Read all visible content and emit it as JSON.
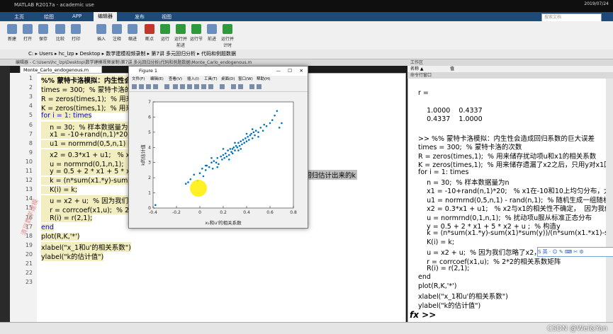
{
  "window": {
    "title": "MATLAB R2017a - academic use",
    "clock": "2019/07/24"
  },
  "ribbon": {
    "tabs": [
      "主页",
      "绘图",
      "APP",
      "编辑器",
      "发布",
      "视图"
    ],
    "active_tab": "编辑器",
    "search_placeholder": "搜索文档",
    "buttons": [
      "新建",
      "打开",
      "保存",
      "比较",
      "打印",
      "插入",
      "注释",
      "缩进",
      "断点",
      "运行",
      "运行并前进",
      "运行节",
      "前进",
      "运行并计时"
    ]
  },
  "pathbar": {
    "path": "C: ▸ Users ▸ hc_lzp ▸ Desktop ▸ 数学建模视频录制 ▸ 第7讲 多元回归分析 ▸ 代码和例题数据"
  },
  "editor": {
    "header": "编辑器 - C:\\Users\\hc_lzp\\Desktop\\数学建模视频录制\\第7讲 多元回归分析\\代码和例题数据\\Monte_Carlo_endogenous.m",
    "tab": "Monte_Carlo_endogenous.m",
    "line_numbers": [
      "1",
      "2",
      "3",
      "4",
      "5",
      "6",
      "7",
      "8",
      "9",
      "10",
      "11",
      "12",
      "13",
      "14",
      "15",
      "16",
      "17",
      "18",
      "19",
      "20",
      "21",
      "22",
      "23"
    ],
    "lines": [
      {
        "t": "%% 蒙特卡洛模拟：内生性会",
        "c": "cm-b"
      },
      {
        "t": "times = 300;  % 蒙特卡洛的次",
        "c": ""
      },
      {
        "t": "R = zeros(times,1);  % 用来储",
        "c": ""
      },
      {
        "t": "K = zeros(times,1);  % 用来储",
        "c": ""
      },
      {
        "t": "for i = 1: times",
        "c": "kw"
      },
      {
        "t": "    n = 30;  % 样本数据量为n",
        "c": ""
      },
      {
        "t": "    x1 = -10+rand(n,1)*20;  %",
        "c": ""
      },
      {
        "t": "    u1 = normrnd(0,5,n,1) - ra",
        "c": ""
      },
      {
        "t": "    x2 = 0.3*x1 + u1;   % x2与",
        "c": ""
      },
      {
        "t": "    u = normrnd(0,1,n,1);  % 扰",
        "c": ""
      },
      {
        "t": "    y = 0.5 + 2 * x1 + 5 * x2 +",
        "c": ""
      },
      {
        "t": "    k = (n*sum(x1.*y)-sum(x1)",
        "c": ""
      },
      {
        "t": "    K(i) = k;",
        "c": ""
      },
      {
        "t": "    u = x2 + u;  % 因为我们忽略",
        "c": ""
      },
      {
        "t": "    r = corrcoef(x1,u);  % 2*2的",
        "c": ""
      },
      {
        "t": "    R(i) = r(2,1);",
        "c": ""
      },
      {
        "t": "end",
        "c": "kw"
      },
      {
        "t": "plot(R,K,'*')",
        "c": ""
      },
      {
        "t": "xlabel(\"x_1和u'的相关系数\")",
        "c": ""
      },
      {
        "t": "ylabel(\"k的估计值\")",
        "c": ""
      },
      {
        "t": "",
        "c": ""
      },
      {
        "t": "",
        "c": ""
      },
      {
        "t": "",
        "c": ""
      }
    ],
    "overflow_text": "回归估计出来的k"
  },
  "figure": {
    "title": "Figure 1",
    "menu": [
      "文件(F)",
      "编辑(E)",
      "查看(V)",
      "插入(I)",
      "工具(T)",
      "桌面(D)",
      "窗口(W)",
      "帮助(H)"
    ],
    "xlabel": "x₁和u'的相关系数",
    "ylabel": "k的估计值"
  },
  "chart_data": {
    "type": "scatter",
    "xlim": [
      -0.4,
      0.8
    ],
    "ylim": [
      0,
      7
    ],
    "xticks": [
      "-0.4",
      "-0.2",
      "0",
      "0.2",
      "0.4",
      "0.6",
      "0.8"
    ],
    "yticks": [
      "0",
      "1",
      "2",
      "3",
      "4",
      "5",
      "6",
      "7"
    ],
    "xlabel": "x₁和u'的相关系数",
    "ylabel": "k的估计值",
    "grid": false,
    "marker_color": "#0072bd",
    "points": [
      [
        -0.38,
        0.2
      ],
      [
        -0.12,
        1.6
      ],
      [
        -0.08,
        1.9
      ],
      [
        -0.05,
        2.2
      ],
      [
        -0.02,
        1.8
      ],
      [
        0.0,
        2.3
      ],
      [
        0.02,
        2.6
      ],
      [
        0.03,
        2.1
      ],
      [
        0.05,
        2.5
      ],
      [
        0.06,
        2.8
      ],
      [
        0.08,
        2.7
      ],
      [
        0.1,
        3.0
      ],
      [
        0.11,
        2.6
      ],
      [
        0.12,
        3.1
      ],
      [
        0.14,
        3.0
      ],
      [
        0.15,
        3.3
      ],
      [
        0.16,
        2.9
      ],
      [
        0.18,
        3.4
      ],
      [
        0.19,
        3.2
      ],
      [
        0.2,
        3.5
      ],
      [
        0.21,
        3.3
      ],
      [
        0.22,
        3.6
      ],
      [
        0.23,
        3.4
      ],
      [
        0.24,
        3.8
      ],
      [
        0.25,
        3.5
      ],
      [
        0.26,
        3.9
      ],
      [
        0.27,
        3.7
      ],
      [
        0.28,
        3.9
      ],
      [
        0.29,
        4.0
      ],
      [
        0.3,
        3.8
      ],
      [
        0.31,
        4.1
      ],
      [
        0.32,
        4.0
      ],
      [
        0.33,
        4.3
      ],
      [
        0.34,
        4.1
      ],
      [
        0.35,
        4.4
      ],
      [
        0.36,
        4.2
      ],
      [
        0.37,
        4.5
      ],
      [
        0.38,
        4.3
      ],
      [
        0.39,
        4.6
      ],
      [
        0.4,
        4.4
      ],
      [
        0.41,
        4.7
      ],
      [
        0.42,
        4.5
      ],
      [
        0.43,
        4.8
      ],
      [
        0.44,
        4.9
      ],
      [
        0.45,
        4.6
      ],
      [
        0.46,
        5.0
      ],
      [
        0.47,
        4.8
      ],
      [
        0.48,
        5.1
      ],
      [
        0.5,
        5.0
      ],
      [
        0.52,
        5.3
      ],
      [
        0.54,
        5.1
      ],
      [
        0.55,
        5.5
      ],
      [
        0.57,
        5.4
      ],
      [
        0.6,
        5.6
      ],
      [
        0.62,
        5.8
      ],
      [
        0.64,
        6.1
      ],
      [
        0.66,
        6.4
      ],
      [
        0.68,
        5.3
      ],
      [
        0.7,
        5.6
      ],
      [
        0.2,
        3.9
      ],
      [
        0.25,
        3.2
      ],
      [
        0.3,
        4.3
      ],
      [
        0.35,
        3.9
      ],
      [
        0.4,
        4.9
      ],
      [
        0.45,
        5.2
      ],
      [
        0.5,
        4.7
      ],
      [
        0.15,
        2.7
      ],
      [
        0.1,
        3.3
      ],
      [
        0.05,
        2.8
      ],
      [
        -0.1,
        1.7
      ],
      [
        0.28,
        3.6
      ],
      [
        0.33,
        3.8
      ]
    ]
  },
  "workspace": {
    "header": "工作区",
    "col_name": "名称 ▲",
    "col_value": "值"
  },
  "command_window": {
    "header": "命令行窗口",
    "lines": [
      {
        "t": "r =",
        "c": ""
      },
      {
        "t": "",
        "c": ""
      },
      {
        "t": "    1.0000    0.4337",
        "c": ""
      },
      {
        "t": "    0.4337    1.0000",
        "c": ""
      },
      {
        "t": "",
        "c": ""
      },
      {
        "t": ">> %% 蒙特卡洛模拟：内生性会造成回归系数的巨大误差",
        "c": "cmg"
      },
      {
        "t": "times = 300;  % 蒙特卡洛的次数",
        "c": ""
      },
      {
        "t": "R = zeros(times,1);  % 用来储存扰动项u和x1的相关系数",
        "c": ""
      },
      {
        "t": "K = zeros(times,1);  % 用来储存遗漏了x2之后，只用y对x1回归得到",
        "c": ""
      },
      {
        "t": "for i = 1: times",
        "c": "kw"
      },
      {
        "t": "    n = 30;  % 样本数据量为n",
        "c": ""
      },
      {
        "t": "    x1 = -10+rand(n,1)*20;   % x1在-10和10上均匀分布，大小为3",
        "c": ""
      },
      {
        "t": "    u1 = normrnd(0,5,n,1) - rand(n,1);  % 随机生成一组随机数",
        "c": ""
      },
      {
        "t": "    x2 = 0.3*x1 + u1;   % x2与x1的相关性不确定，  因为我们设定了",
        "c": ""
      },
      {
        "t": "    u = normrnd(0,1,n,1);  % 扰动项u服从标准正态分布",
        "c": ""
      },
      {
        "t": "    y = 0.5 + 2 * x1 + 5 * x2 + u ;  % 构造y",
        "c": ""
      },
      {
        "t": "    k = (n*sum(x1.*y)-sum(x1)*sum(y))/(n*sum(x1.*x1)-sum(x1)*",
        "c": ""
      },
      {
        "t": "    K(i) = k;",
        "c": ""
      },
      {
        "t": "    u = x2 + u;  % 因为我们忽略了x2，所以",
        "c": ""
      },
      {
        "t": "    r = corrcoef(x1,u);  % 2*2的相关系数矩阵",
        "c": ""
      },
      {
        "t": "    R(i) = r(2,1);",
        "c": ""
      },
      {
        "t": "end",
        "c": "kw"
      },
      {
        "t": "plot(R,K,'*')",
        "c": ""
      },
      {
        "t": "xlabel(\"x_1和u'的相关系数\")",
        "c": ""
      },
      {
        "t": "ylabel(\"k的估计值\")",
        "c": ""
      },
      {
        "t": "",
        "c": ""
      }
    ],
    "prompt": "fx >>",
    "ime": "S 英 ‧ ☺ ✎ ⌨ ✂ ⚙"
  },
  "watermark": "清风数学建模",
  "credit": "CSDN @Wei&Yan"
}
